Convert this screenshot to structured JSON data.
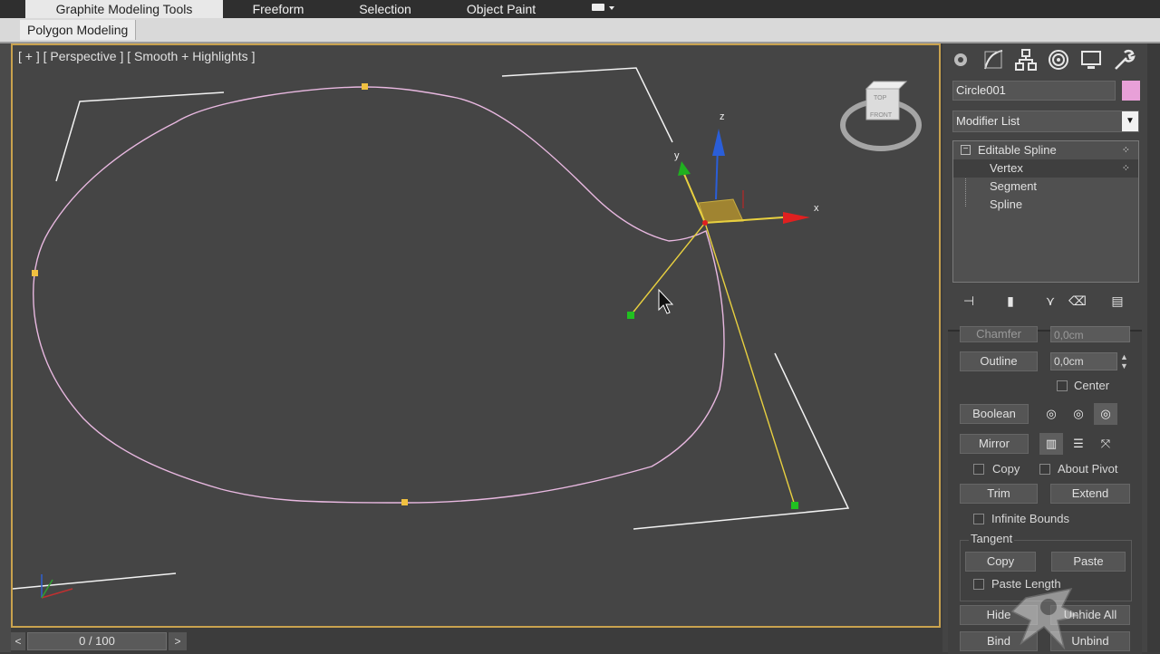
{
  "ribbon": {
    "tabs": [
      "Graphite Modeling Tools",
      "Freeform",
      "Selection",
      "Object Paint"
    ],
    "active_tab": "Graphite Modeling Tools",
    "sub_panel": "Polygon Modeling",
    "extra_icon": "display-icon"
  },
  "viewport": {
    "label": "[ + ] [ Perspective ] [ Smooth + Highlights ]",
    "gizmo_axes": {
      "x": "x",
      "y": "y",
      "z": "z"
    },
    "viewcube": {
      "top": "TOP",
      "front": "FRONT"
    }
  },
  "timeline": {
    "prev": "<",
    "position": "0 / 100",
    "next": ">"
  },
  "command_panel": {
    "tabs": [
      "create-icon",
      "modify-icon",
      "hierarchy-icon",
      "motion-icon",
      "display-icon",
      "utilities-icon"
    ],
    "object_name": "Circle001",
    "object_color": "#e8a0d8",
    "modifier_list": "Modifier List",
    "stack": {
      "root": "Editable Spline",
      "children": [
        "Vertex",
        "Segment",
        "Spline"
      ],
      "selected": "Vertex"
    },
    "geometry": {
      "chamfer_label": "Chamfer",
      "chamfer_value": "0,0cm",
      "outline_label": "Outline",
      "outline_value": "0,0cm",
      "center_label": "Center",
      "boolean_label": "Boolean",
      "mirror_label": "Mirror",
      "copy_label": "Copy",
      "about_pivot_label": "About Pivot",
      "trim_label": "Trim",
      "extend_label": "Extend",
      "infinite_bounds_label": "Infinite Bounds",
      "tangent_group": "Tangent",
      "tangent_copy": "Copy",
      "tangent_paste": "Paste",
      "paste_length_label": "Paste Length",
      "hide_label": "Hide",
      "unhide_all_label": "Unhide All",
      "bind_label": "Bind",
      "unbind_label": "Unbind"
    }
  },
  "colors": {
    "viewport_bg": "#454545",
    "viewport_border": "#c9a24e",
    "spline": "#e8b8e0",
    "vertex": "#f0c040",
    "tangent_handle": "#e8d040",
    "handle_end": "#20c020"
  }
}
